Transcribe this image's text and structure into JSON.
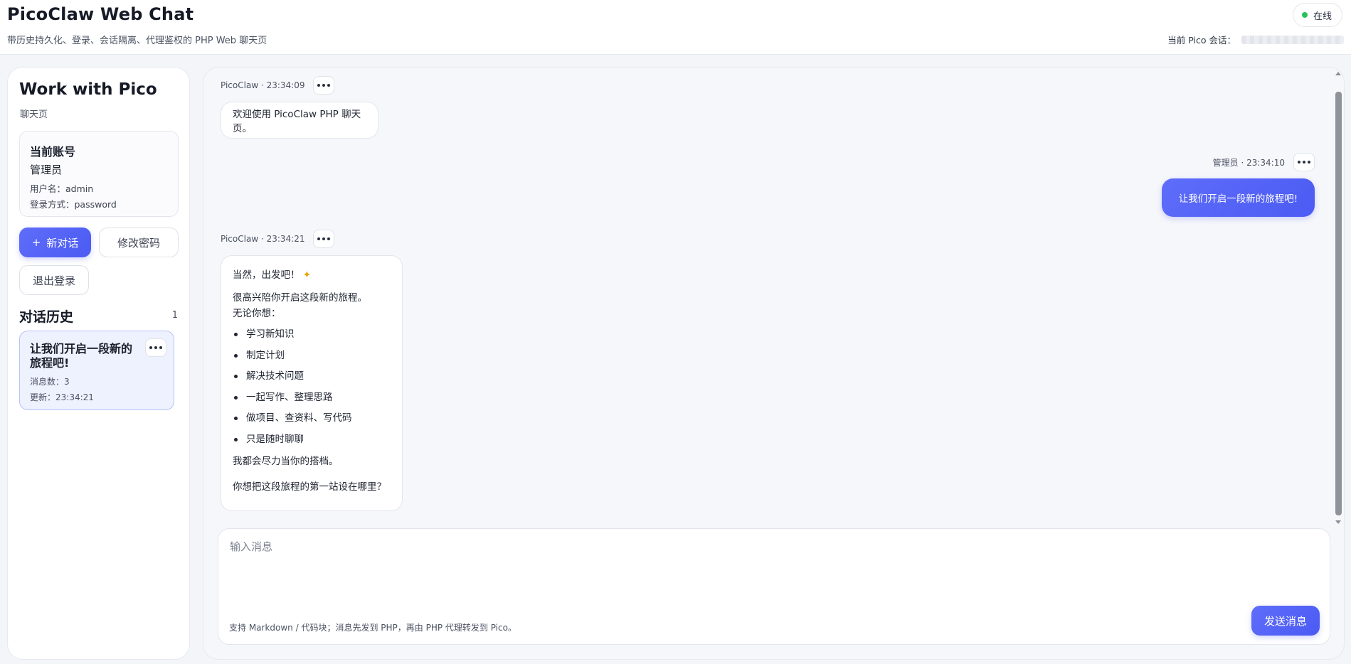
{
  "header": {
    "title": "PicoClaw Web Chat",
    "subtitle": "带历史持久化、登录、会话隔离、代理鉴权的 PHP Web 聊天页",
    "status": "在线",
    "session_label": "当前 Pico 会话："
  },
  "sidebar": {
    "title": "Work with Pico",
    "subtitle": "聊天页",
    "account": {
      "heading": "当前账号",
      "role": "管理员",
      "username": "用户名：admin",
      "login_method": "登录方式：password"
    },
    "new_chat_icon": "+",
    "new_chat_label": "新对话",
    "change_password_label": "修改密码",
    "logout_label": "退出登录",
    "history_title": "对话历史",
    "history_count": "1",
    "history_items": [
      {
        "title": "让我们开启一段新的旅程吧!",
        "message_count": "消息数：3",
        "updated": "更新：23:34:21"
      }
    ]
  },
  "messages": [
    {
      "role": "assistant",
      "meta": "PicoClaw · 23:34:09",
      "text": "欢迎使用 PicoClaw PHP 聊天页。"
    },
    {
      "role": "user",
      "meta": "管理员 · 23:34:10",
      "text": "让我们开启一段新的旅程吧!"
    },
    {
      "role": "assistant",
      "meta": "PicoClaw · 23:34:21",
      "intro": "当然，出发吧！",
      "intro_emoji": "sparkle-icon",
      "line1": "很高兴陪你开启这段新的旅程。",
      "line2": "无论你想：",
      "list": [
        "学习新知识",
        "制定计划",
        "解决技术问题",
        "一起写作、整理思路",
        "做项目、查资料、写代码",
        "只是随时聊聊"
      ],
      "closing1": "我都会尽力当你的搭档。",
      "closing2": "你想把这段旅程的第一站设在哪里？"
    }
  ],
  "composer": {
    "placeholder": "输入消息",
    "hint": "支持 Markdown / 代码块；消息先发到 PHP，再由 PHP 代理转发到 Pico。",
    "send_label": "发送消息"
  },
  "colors": {
    "accent": "#4f5df5",
    "online": "#26c25a",
    "history_active_bg": "#eef1fe",
    "history_active_border": "#b8c2fb"
  }
}
